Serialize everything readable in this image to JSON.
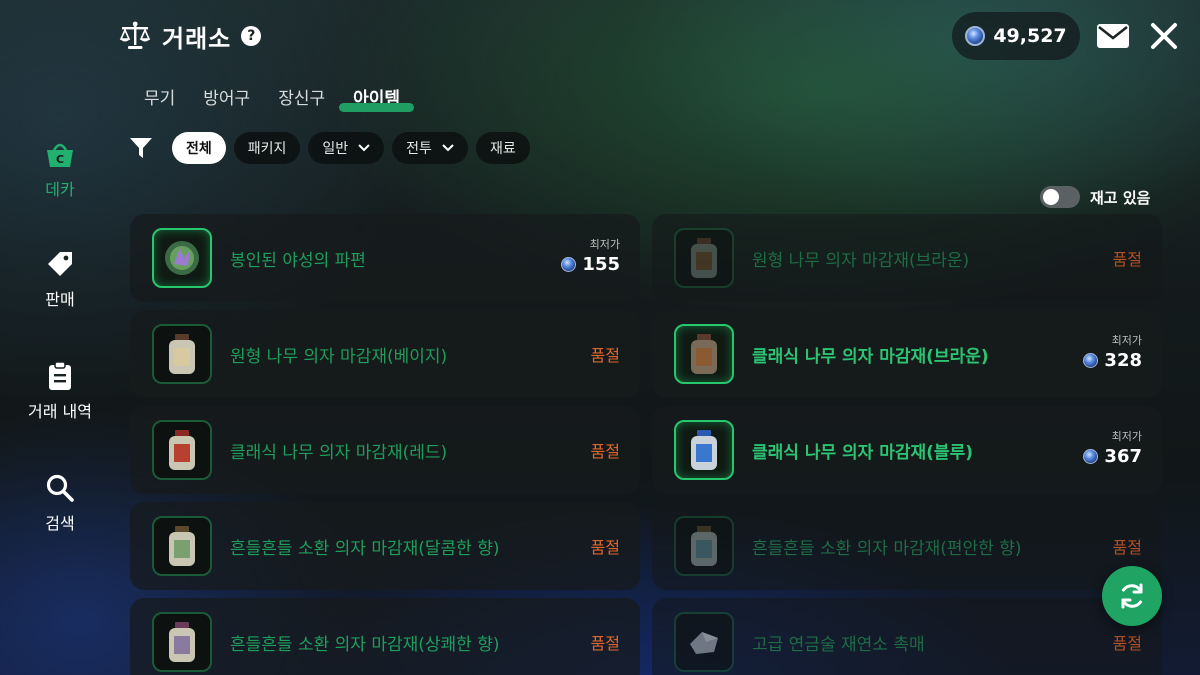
{
  "header": {
    "title": "거래소",
    "currency_amount": "49,527",
    "icons": {
      "title": "scale-icon",
      "help": "help-icon",
      "currency": "crystal-coin-icon",
      "mail": "mail-icon",
      "close": "close-icon"
    },
    "help_glyph": "?"
  },
  "tabs": [
    {
      "label": "무기",
      "active": false
    },
    {
      "label": "방어구",
      "active": false
    },
    {
      "label": "장신구",
      "active": false
    },
    {
      "label": "아이템",
      "active": true
    }
  ],
  "filters": {
    "chips": [
      {
        "label": "전체",
        "active": true,
        "dropdown": false
      },
      {
        "label": "패키지",
        "active": false,
        "dropdown": false
      },
      {
        "label": "일반",
        "active": false,
        "dropdown": true
      },
      {
        "label": "전투",
        "active": false,
        "dropdown": true
      },
      {
        "label": "재료",
        "active": false,
        "dropdown": false
      }
    ]
  },
  "stock_toggle": {
    "label": "재고 있음",
    "on": false
  },
  "sidebar": [
    {
      "label": "데카",
      "icon": "basket-icon",
      "active": true
    },
    {
      "label": "판매",
      "icon": "tag-icon",
      "active": false
    },
    {
      "label": "거래 내역",
      "icon": "clipboard-icon",
      "active": false
    },
    {
      "label": "검색",
      "icon": "search-icon",
      "active": false
    }
  ],
  "items": [
    {
      "name": "봉인된 야성의 파편",
      "status": "price",
      "price_label": "최저가",
      "price": "155",
      "style": "normal"
    },
    {
      "name": "원형 나무 의자 마감재(브라운)",
      "status": "sold_out",
      "status_text": "품절",
      "style": "dim"
    },
    {
      "name": "원형 나무 의자 마감재(베이지)",
      "status": "sold_out",
      "status_text": "품절",
      "style": "normal"
    },
    {
      "name": "클래식 나무 의자 마감재(브라운)",
      "status": "price",
      "price_label": "최저가",
      "price": "328",
      "style": "lit"
    },
    {
      "name": "클래식 나무 의자 마감재(레드)",
      "status": "sold_out",
      "status_text": "품절",
      "style": "normal"
    },
    {
      "name": "클래식 나무 의자 마감재(블루)",
      "status": "price",
      "price_label": "최저가",
      "price": "367",
      "style": "lit"
    },
    {
      "name": "흔들흔들 소환 의자 마감재(달콤한 향)",
      "status": "sold_out",
      "status_text": "품절",
      "style": "normal"
    },
    {
      "name": "흔들흔들 소환 의자 마감재(편안한 향)",
      "status": "sold_out",
      "status_text": "품절",
      "style": "dim"
    },
    {
      "name": "흔들흔들 소환 의자 마감재(상쾌한 향)",
      "status": "sold_out",
      "status_text": "품절",
      "style": "normal"
    },
    {
      "name": "고급 연금술 재연소 촉매",
      "status": "sold_out",
      "status_text": "품절",
      "style": "dim"
    }
  ],
  "refresh_icon": "refresh-icon",
  "colors": {
    "accent": "#1fa463",
    "item_name": "#1f9d5c",
    "sold_out": "#e0662c"
  }
}
